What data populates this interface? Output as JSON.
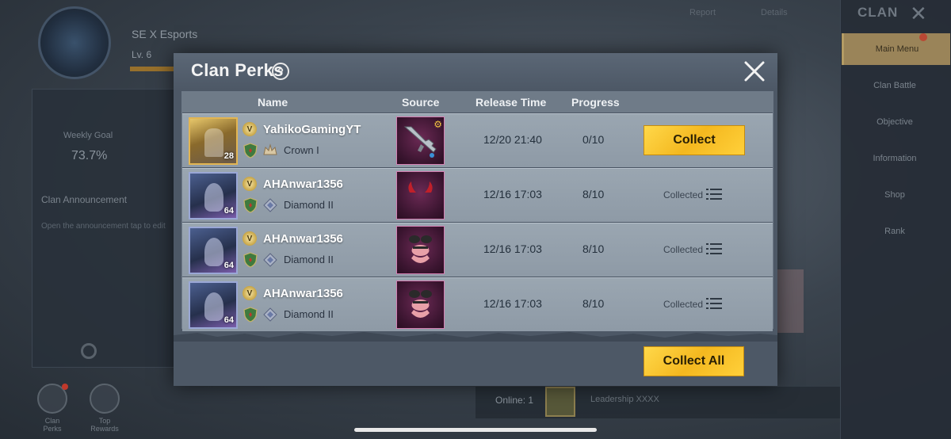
{
  "modal": {
    "title": "Clan Perks",
    "help": "?",
    "columns": [
      "Name",
      "Source",
      "Release Time",
      "Progress"
    ],
    "rows": [
      {
        "player": "YahikoGamingYT",
        "level": "28",
        "rank": "Crown I",
        "item": "rifle-skin",
        "release_time": "12/20 21:40",
        "progress": "0/10",
        "status": "collect",
        "action_label": "Collect"
      },
      {
        "player": "AHAnwar1356",
        "level": "64",
        "rank": "Diamond II",
        "item": "devil-horns",
        "release_time": "12/16 17:03",
        "progress": "8/10",
        "status": "collected",
        "action_label": "Collected"
      },
      {
        "player": "AHAnwar1356",
        "level": "64",
        "rank": "Diamond II",
        "item": "outfit",
        "release_time": "12/16 17:03",
        "progress": "8/10",
        "status": "collected",
        "action_label": "Collected"
      },
      {
        "player": "AHAnwar1356",
        "level": "64",
        "rank": "Diamond II",
        "item": "outfit",
        "release_time": "12/16 17:03",
        "progress": "8/10",
        "status": "collected",
        "action_label": "Collected"
      }
    ],
    "collect_all_label": "Collect All"
  },
  "background": {
    "clan_name": "SE X Esports",
    "clan_level": "Lv. 6",
    "activity_label": "Weekly Goal",
    "activity_value": "73.7%",
    "announcement_title": "Clan Announcement",
    "announcement_text": "Open the announcement tap to edit",
    "report": "Report",
    "details": "Details",
    "sidebar_title": "CLAN",
    "sidebar_items": [
      "Main Menu",
      "Clan Battle",
      "Objective",
      "Information",
      "Shop",
      "Rank"
    ],
    "bottom_buttons": [
      "Clan Perks",
      "Top Rewards"
    ],
    "online_label": "Online: 1",
    "member_name": "Leadership XXXX"
  },
  "colors": {
    "accent_yellow": "#f4b81f",
    "modal_bg": "#4d5866",
    "row_bg": "#9aa6b1"
  }
}
